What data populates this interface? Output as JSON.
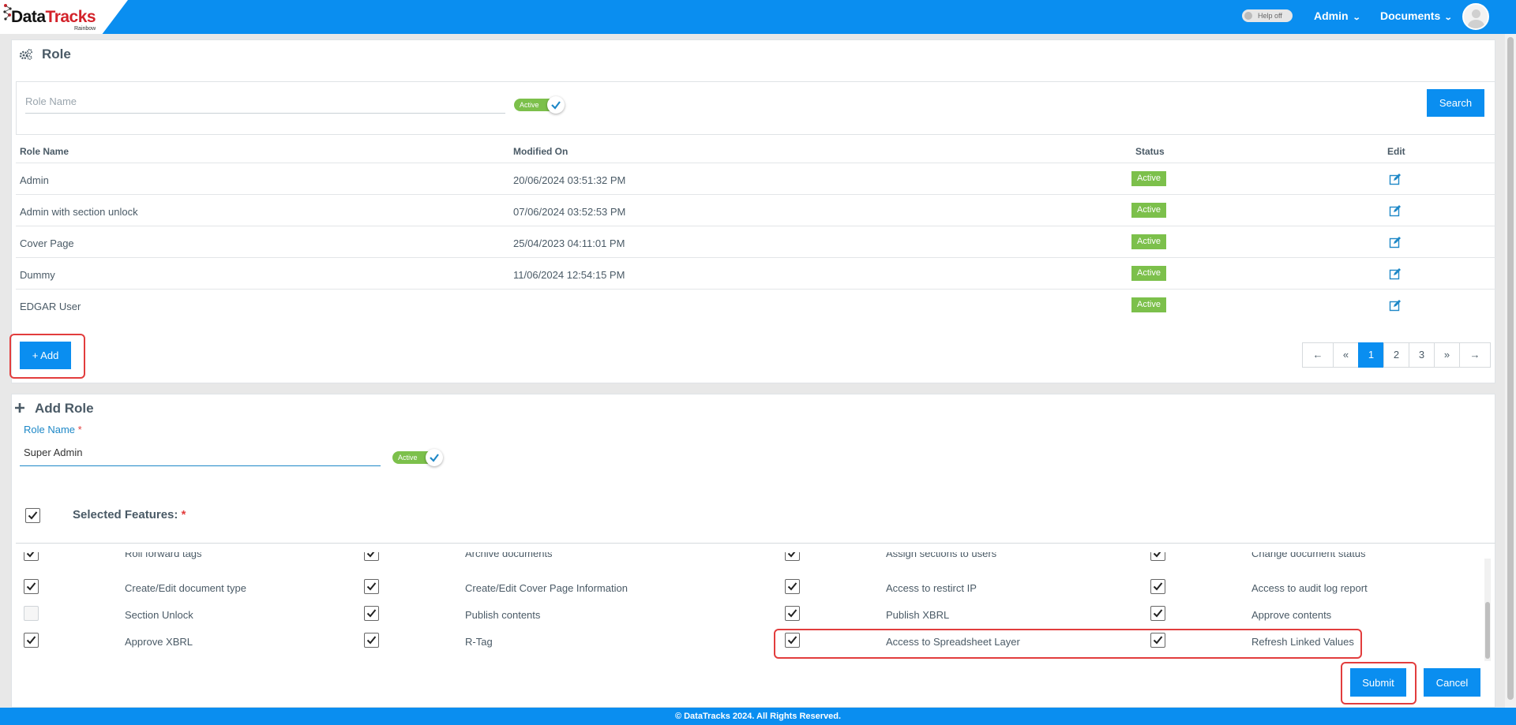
{
  "header": {
    "logo_main": "Data",
    "logo_accent": "Tracks",
    "logo_sub": "Rainbow",
    "help_toggle": "Help off",
    "admin_menu": "Admin",
    "documents_menu": "Documents"
  },
  "role_panel": {
    "title": "Role",
    "search_placeholder": "Role Name",
    "status_toggle": "Active",
    "search_button": "Search",
    "columns": [
      "Role Name",
      "Modified On",
      "Status",
      "Edit"
    ],
    "rows": [
      {
        "name": "Admin",
        "modified": "20/06/2024 03:51:32 PM",
        "status": "Active"
      },
      {
        "name": "Admin with section unlock",
        "modified": "07/06/2024 03:52:53 PM",
        "status": "Active"
      },
      {
        "name": "Cover Page",
        "modified": "25/04/2023 04:11:01 PM",
        "status": "Active"
      },
      {
        "name": "Dummy",
        "modified": "11/06/2024 12:54:15 PM",
        "status": "Active"
      },
      {
        "name": "EDGAR User",
        "modified": "",
        "status": "Active"
      }
    ],
    "add_button": "+ Add",
    "pagination": [
      "←",
      "«",
      "1",
      "2",
      "3",
      "»",
      "→"
    ],
    "current_page": "1"
  },
  "add_role": {
    "title": "Add Role",
    "role_name_label": "Role Name",
    "required_mark": "*",
    "role_name_value": "Super Admin",
    "status_toggle": "Active",
    "selected_features_label": "Selected Features:",
    "features": [
      [
        {
          "label": "Roll forward tags",
          "checked": true
        },
        {
          "label": "Archive documents",
          "checked": true
        },
        {
          "label": "Assign sections to users",
          "checked": true
        },
        {
          "label": "Change document status",
          "checked": true
        }
      ],
      [
        {
          "label": "Create/Edit document type",
          "checked": true
        },
        {
          "label": "Create/Edit Cover Page Information",
          "checked": true
        },
        {
          "label": "Access to restirct IP",
          "checked": true
        },
        {
          "label": "Access to audit log report",
          "checked": true
        }
      ],
      [
        {
          "label": "Section Unlock",
          "checked": false
        },
        {
          "label": "Publish contents",
          "checked": true
        },
        {
          "label": "Publish XBRL",
          "checked": true
        },
        {
          "label": "Approve contents",
          "checked": true
        }
      ],
      [
        {
          "label": "Approve XBRL",
          "checked": true
        },
        {
          "label": "R-Tag",
          "checked": true
        },
        {
          "label": "Access to Spreadsheet Layer",
          "checked": true
        },
        {
          "label": "Refresh Linked Values",
          "checked": true
        }
      ]
    ],
    "submit_button": "Submit",
    "cancel_button": "Cancel"
  },
  "footer": {
    "copyright": "© DataTracks 2024. All Rights Reserved."
  },
  "colors": {
    "primary": "#0a8ef0",
    "active_badge": "#7cc04b",
    "highlight": "#e23d3d"
  }
}
